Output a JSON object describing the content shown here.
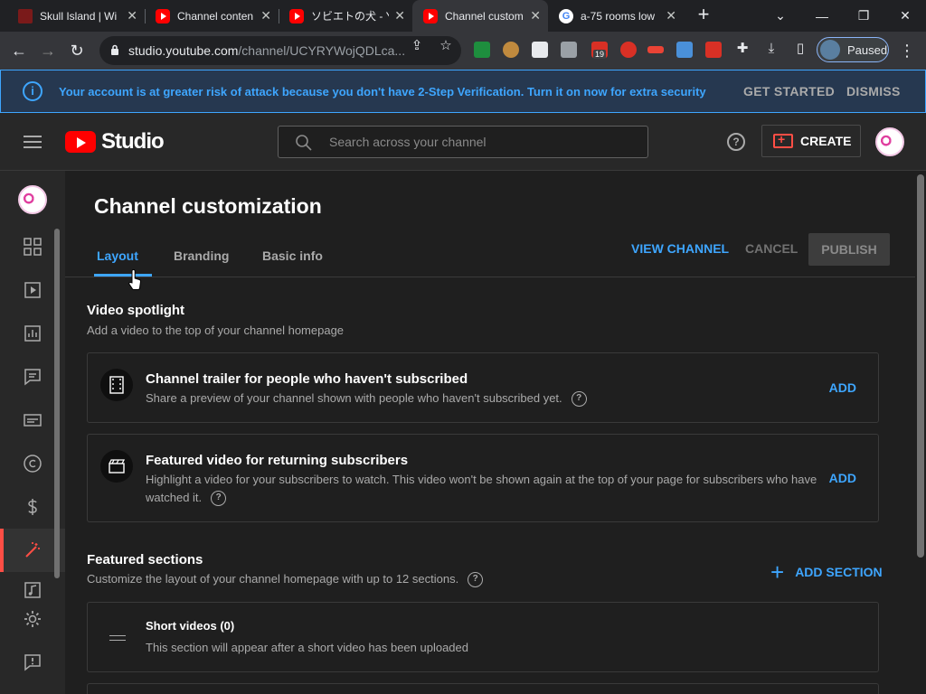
{
  "browser": {
    "tabs": [
      {
        "title": "Skull Island | Wi",
        "favicon": "skull-island-icon"
      },
      {
        "title": "Channel conten",
        "favicon": "youtube-icon"
      },
      {
        "title": "ソビエトの犬 - You",
        "favicon": "youtube-icon"
      },
      {
        "title": "Channel custom",
        "favicon": "youtube-icon",
        "active": true
      },
      {
        "title": "a-75 rooms low",
        "favicon": "google-icon"
      }
    ],
    "url_host": "studio.youtube.com",
    "url_path": "/channel/UCYRYWojQDLca...",
    "ext_badge": "19",
    "profile_label": "Paused"
  },
  "banner": {
    "message": "Your account is at greater risk of attack because you don't have 2-Step Verification. Turn it on now for extra security",
    "get_started": "GET STARTED",
    "dismiss": "DISMISS"
  },
  "header": {
    "logo_text": "Studio",
    "search_placeholder": "Search across your channel",
    "help": "?",
    "create_label": "CREATE"
  },
  "page": {
    "title": "Channel customization",
    "tabs": [
      "Layout",
      "Branding",
      "Basic info"
    ],
    "active_tab": "Layout",
    "view_channel": "VIEW CHANNEL",
    "cancel": "CANCEL",
    "publish": "PUBLISH"
  },
  "spotlight": {
    "title": "Video spotlight",
    "subtitle": "Add a video to the top of your channel homepage",
    "trailer": {
      "title": "Channel trailer for people who haven't subscribed",
      "desc": "Share a preview of your channel shown with people who haven't subscribed yet.",
      "action": "ADD"
    },
    "featured": {
      "title": "Featured video for returning subscribers",
      "desc": "Highlight a video for your subscribers to watch. This video won't be shown again at the top of your page for subscribers who have watched it.",
      "action": "ADD"
    }
  },
  "sections": {
    "title": "Featured sections",
    "subtitle": "Customize the layout of your channel homepage with up to 12 sections.",
    "add_section": "ADD SECTION",
    "items": [
      {
        "title": "Short videos (0)",
        "desc": "This section will appear after a short video has been uploaded"
      }
    ]
  },
  "colors": {
    "accent": "#3ea6ff",
    "brand_red": "#ff0000",
    "active_indicator": "#ff4e45",
    "background": "#1f1f1f"
  }
}
